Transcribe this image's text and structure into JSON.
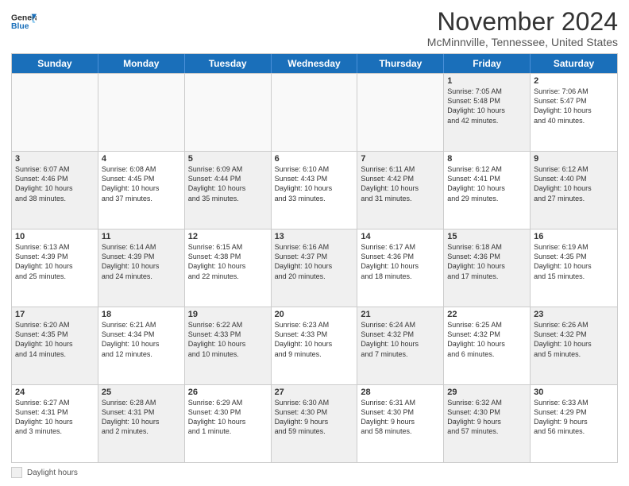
{
  "header": {
    "logo_line1": "General",
    "logo_line2": "Blue",
    "main_title": "November 2024",
    "subtitle": "McMinnville, Tennessee, United States"
  },
  "calendar": {
    "days_of_week": [
      "Sunday",
      "Monday",
      "Tuesday",
      "Wednesday",
      "Thursday",
      "Friday",
      "Saturday"
    ],
    "rows": [
      [
        {
          "day": "",
          "info": "",
          "empty": true
        },
        {
          "day": "",
          "info": "",
          "empty": true
        },
        {
          "day": "",
          "info": "",
          "empty": true
        },
        {
          "day": "",
          "info": "",
          "empty": true
        },
        {
          "day": "",
          "info": "",
          "empty": true
        },
        {
          "day": "1",
          "info": "Sunrise: 7:05 AM\nSunset: 5:48 PM\nDaylight: 10 hours\nand 42 minutes.",
          "shaded": true
        },
        {
          "day": "2",
          "info": "Sunrise: 7:06 AM\nSunset: 5:47 PM\nDaylight: 10 hours\nand 40 minutes.",
          "shaded": false
        }
      ],
      [
        {
          "day": "3",
          "info": "Sunrise: 6:07 AM\nSunset: 4:46 PM\nDaylight: 10 hours\nand 38 minutes.",
          "shaded": true
        },
        {
          "day": "4",
          "info": "Sunrise: 6:08 AM\nSunset: 4:45 PM\nDaylight: 10 hours\nand 37 minutes.",
          "shaded": false
        },
        {
          "day": "5",
          "info": "Sunrise: 6:09 AM\nSunset: 4:44 PM\nDaylight: 10 hours\nand 35 minutes.",
          "shaded": true
        },
        {
          "day": "6",
          "info": "Sunrise: 6:10 AM\nSunset: 4:43 PM\nDaylight: 10 hours\nand 33 minutes.",
          "shaded": false
        },
        {
          "day": "7",
          "info": "Sunrise: 6:11 AM\nSunset: 4:42 PM\nDaylight: 10 hours\nand 31 minutes.",
          "shaded": true
        },
        {
          "day": "8",
          "info": "Sunrise: 6:12 AM\nSunset: 4:41 PM\nDaylight: 10 hours\nand 29 minutes.",
          "shaded": false
        },
        {
          "day": "9",
          "info": "Sunrise: 6:12 AM\nSunset: 4:40 PM\nDaylight: 10 hours\nand 27 minutes.",
          "shaded": true
        }
      ],
      [
        {
          "day": "10",
          "info": "Sunrise: 6:13 AM\nSunset: 4:39 PM\nDaylight: 10 hours\nand 25 minutes.",
          "shaded": false
        },
        {
          "day": "11",
          "info": "Sunrise: 6:14 AM\nSunset: 4:39 PM\nDaylight: 10 hours\nand 24 minutes.",
          "shaded": true
        },
        {
          "day": "12",
          "info": "Sunrise: 6:15 AM\nSunset: 4:38 PM\nDaylight: 10 hours\nand 22 minutes.",
          "shaded": false
        },
        {
          "day": "13",
          "info": "Sunrise: 6:16 AM\nSunset: 4:37 PM\nDaylight: 10 hours\nand 20 minutes.",
          "shaded": true
        },
        {
          "day": "14",
          "info": "Sunrise: 6:17 AM\nSunset: 4:36 PM\nDaylight: 10 hours\nand 18 minutes.",
          "shaded": false
        },
        {
          "day": "15",
          "info": "Sunrise: 6:18 AM\nSunset: 4:36 PM\nDaylight: 10 hours\nand 17 minutes.",
          "shaded": true
        },
        {
          "day": "16",
          "info": "Sunrise: 6:19 AM\nSunset: 4:35 PM\nDaylight: 10 hours\nand 15 minutes.",
          "shaded": false
        }
      ],
      [
        {
          "day": "17",
          "info": "Sunrise: 6:20 AM\nSunset: 4:35 PM\nDaylight: 10 hours\nand 14 minutes.",
          "shaded": true
        },
        {
          "day": "18",
          "info": "Sunrise: 6:21 AM\nSunset: 4:34 PM\nDaylight: 10 hours\nand 12 minutes.",
          "shaded": false
        },
        {
          "day": "19",
          "info": "Sunrise: 6:22 AM\nSunset: 4:33 PM\nDaylight: 10 hours\nand 10 minutes.",
          "shaded": true
        },
        {
          "day": "20",
          "info": "Sunrise: 6:23 AM\nSunset: 4:33 PM\nDaylight: 10 hours\nand 9 minutes.",
          "shaded": false
        },
        {
          "day": "21",
          "info": "Sunrise: 6:24 AM\nSunset: 4:32 PM\nDaylight: 10 hours\nand 7 minutes.",
          "shaded": true
        },
        {
          "day": "22",
          "info": "Sunrise: 6:25 AM\nSunset: 4:32 PM\nDaylight: 10 hours\nand 6 minutes.",
          "shaded": false
        },
        {
          "day": "23",
          "info": "Sunrise: 6:26 AM\nSunset: 4:32 PM\nDaylight: 10 hours\nand 5 minutes.",
          "shaded": true
        }
      ],
      [
        {
          "day": "24",
          "info": "Sunrise: 6:27 AM\nSunset: 4:31 PM\nDaylight: 10 hours\nand 3 minutes.",
          "shaded": false
        },
        {
          "day": "25",
          "info": "Sunrise: 6:28 AM\nSunset: 4:31 PM\nDaylight: 10 hours\nand 2 minutes.",
          "shaded": true
        },
        {
          "day": "26",
          "info": "Sunrise: 6:29 AM\nSunset: 4:30 PM\nDaylight: 10 hours\nand 1 minute.",
          "shaded": false
        },
        {
          "day": "27",
          "info": "Sunrise: 6:30 AM\nSunset: 4:30 PM\nDaylight: 9 hours\nand 59 minutes.",
          "shaded": true
        },
        {
          "day": "28",
          "info": "Sunrise: 6:31 AM\nSunset: 4:30 PM\nDaylight: 9 hours\nand 58 minutes.",
          "shaded": false
        },
        {
          "day": "29",
          "info": "Sunrise: 6:32 AM\nSunset: 4:30 PM\nDaylight: 9 hours\nand 57 minutes.",
          "shaded": true
        },
        {
          "day": "30",
          "info": "Sunrise: 6:33 AM\nSunset: 4:29 PM\nDaylight: 9 hours\nand 56 minutes.",
          "shaded": false
        }
      ]
    ]
  },
  "legend": {
    "shaded_label": "Daylight hours"
  }
}
